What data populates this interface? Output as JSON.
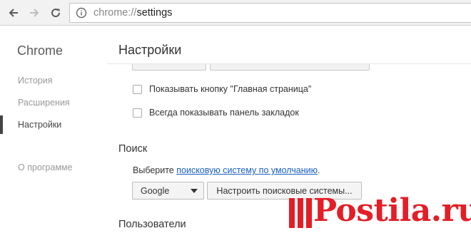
{
  "browser": {
    "address": {
      "scheme": "chrome://",
      "host": "settings"
    },
    "icons": {
      "back": "back-arrow-icon",
      "forward": "forward-arrow-icon",
      "reload": "reload-icon",
      "info": "info-icon"
    }
  },
  "sidebar": {
    "brand": "Chrome",
    "items": [
      {
        "label": "История",
        "active": false
      },
      {
        "label": "Расширения",
        "active": false
      },
      {
        "label": "Настройки",
        "active": true
      },
      {
        "label": "О программе",
        "active": false
      }
    ]
  },
  "main": {
    "title": "Настройки",
    "appearance": {
      "show_home_button": {
        "label": "Показывать кнопку \"Главная страница\"",
        "checked": false
      },
      "show_bookmarks_bar": {
        "label": "Всегда показывать панель закладок",
        "checked": false
      }
    },
    "search": {
      "title": "Поиск",
      "description_prefix": "Выберите ",
      "description_link": "поисковую систему по умолчанию",
      "description_suffix": ".",
      "engine_selected": "Google",
      "manage_button": "Настроить поисковые системы..."
    },
    "users": {
      "title": "Пользователи"
    }
  },
  "watermark": {
    "text": "Postila.ru"
  },
  "colors": {
    "link": "#1a5fbf",
    "watermark": "#e31e27",
    "active_indicator": "#444444"
  }
}
